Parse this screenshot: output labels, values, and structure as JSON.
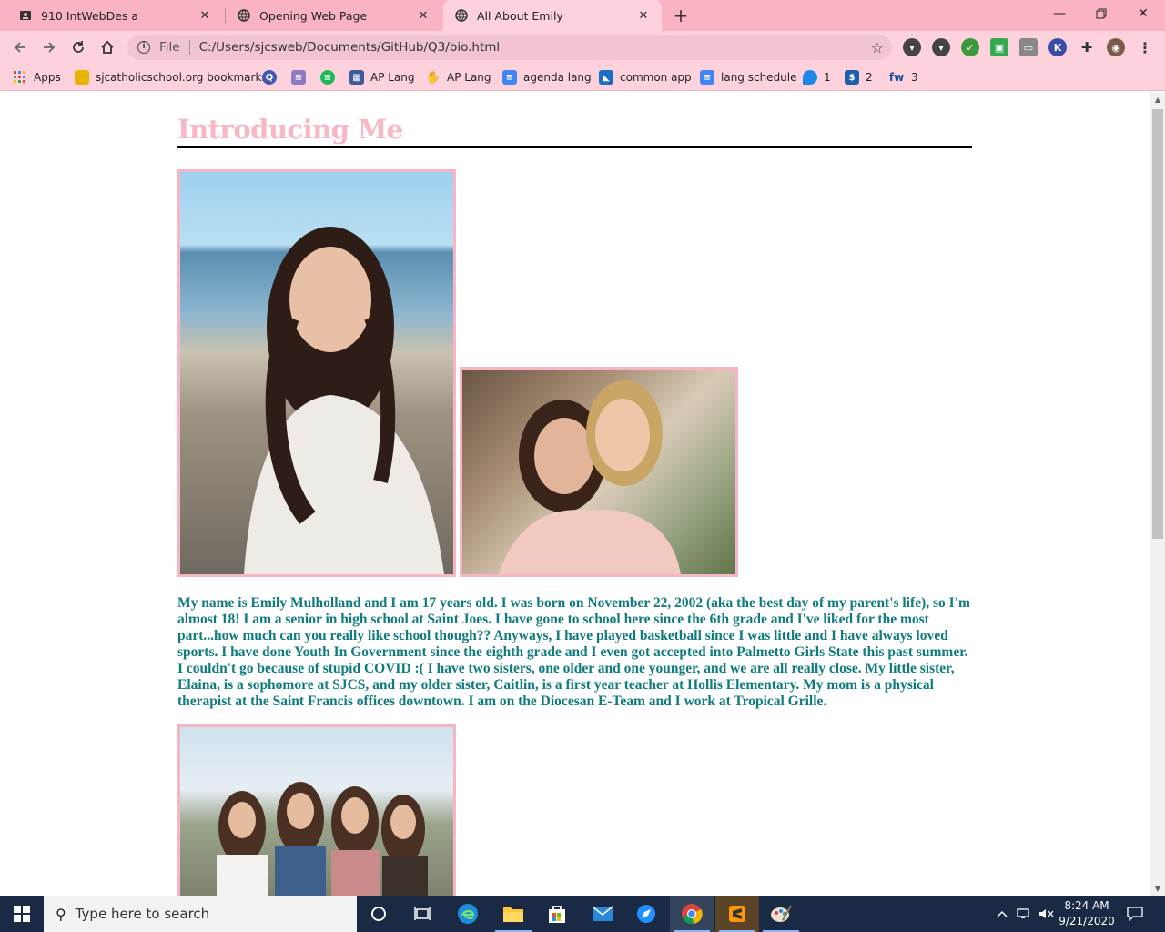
{
  "browser": {
    "tabs": [
      {
        "title": "910 IntWebDes a",
        "favicon": "classroom-icon",
        "active": false
      },
      {
        "title": "Opening Web Page",
        "favicon": "globe-icon",
        "active": false
      },
      {
        "title": "All About Emily",
        "favicon": "globe-icon",
        "active": true
      }
    ],
    "address": {
      "scheme": "File",
      "url": "C:/Users/sjcsweb/Documents/GitHub/Q3/bio.html"
    },
    "bookmarks": [
      {
        "label": "Apps",
        "icon": "apps-grid-icon"
      },
      {
        "label": "sjcatholicschool.org bookmarks",
        "icon": "folder-icon"
      },
      {
        "label": "",
        "icon": "quizlet-icon"
      },
      {
        "label": "",
        "icon": "layers-icon"
      },
      {
        "label": "",
        "icon": "spotify-icon"
      },
      {
        "label": "AP Lang",
        "icon": "calendar-icon"
      },
      {
        "label": "AP Lang",
        "icon": "hand-icon"
      },
      {
        "label": "agenda lang",
        "icon": "docs-icon"
      },
      {
        "label": "common app",
        "icon": "common-app-icon"
      },
      {
        "label": "lang schedule",
        "icon": "docs-icon"
      },
      {
        "label": "1",
        "icon": "chat-icon"
      },
      {
        "label": "2",
        "icon": "dollar-icon"
      },
      {
        "label": "3",
        "icon": "fw-icon"
      }
    ],
    "colors": {
      "tab_bar": "#f9b3c3",
      "toolbar": "#fdd2dc"
    }
  },
  "page": {
    "heading": "Introducing Me",
    "bio": "My name is Emily Mulholland and I am 17 years old. I was born on November 22, 2002 (aka the best day of my parent's life), so I'm almost 18! I am a senior in high school at Saint Joes. I have gone to school here since the 6th grade and I've liked for the most part...how much can you really like school though?? Anyways, I have played basketball since I was little and I have always loved sports. I have done Youth In Government since the eighth grade and I even got accepted into Palmetto Girls State this past summer. I couldn't go because of stupid COVID :( I have two sisters, one older and one younger, and we are all really close. My little sister, Elaina, is a sophomore at SJCS, and my older sister, Caitlin, is a first year teacher at Hollis Elementary. My mom is a physical therapist at the Saint Francis offices downtown. I am on the Diocesan E-Team and I work at Tropical Grille.",
    "colors": {
      "heading": "#f9b7c6",
      "bio_text": "#0e7b7e",
      "photo_border": "#f7b6c5"
    }
  },
  "taskbar": {
    "search_placeholder": "Type here to search",
    "time": "8:24 AM",
    "date": "9/21/2020"
  }
}
